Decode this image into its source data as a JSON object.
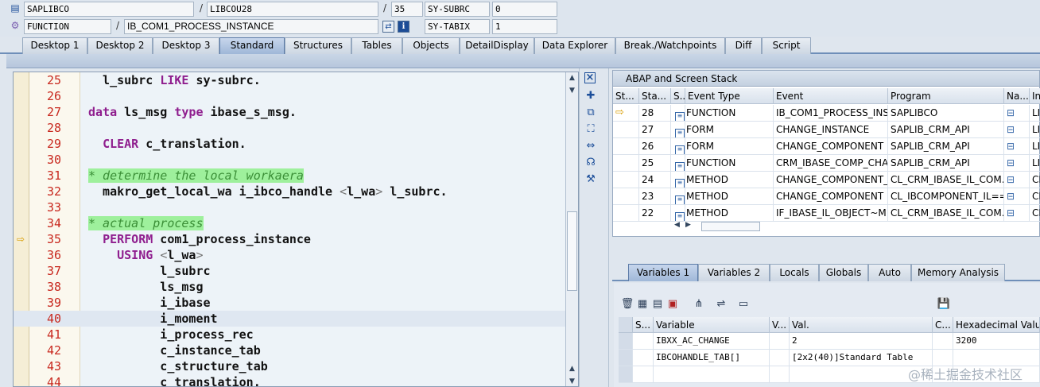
{
  "header": {
    "row1": {
      "program": "SAPLIBCO",
      "include": "LIBCOU28",
      "line": "35",
      "sysfield_label": "SY-SUBRC",
      "sysfield_value": "0"
    },
    "row2": {
      "type": "FUNCTION",
      "name": "IB_COM1_PROCESS_INSTANCE",
      "sysfield_label": "SY-TABIX",
      "sysfield_value": "1"
    },
    "separator": "/",
    "info_label": "i"
  },
  "tabs": [
    "Desktop 1",
    "Desktop 2",
    "Desktop 3",
    "Standard",
    "Structures",
    "Tables",
    "Objects",
    "DetailDisplay",
    "Data Explorer",
    "Break./Watchpoints",
    "Diff",
    "Script"
  ],
  "code": {
    "lines": [
      {
        "n": "25",
        "text": "  l_subrc LIKE sy-subrc."
      },
      {
        "n": "26",
        "text": ""
      },
      {
        "n": "27",
        "text": "data ls_msg type ibase_s_msg."
      },
      {
        "n": "28",
        "text": ""
      },
      {
        "n": "29",
        "text": "  CLEAR c_translation."
      },
      {
        "n": "30",
        "text": ""
      },
      {
        "n": "31",
        "text": "* determine the local workaera"
      },
      {
        "n": "32",
        "text": "  makro_get_local_wa i_ibco_handle <l_wa> l_subrc."
      },
      {
        "n": "33",
        "text": ""
      },
      {
        "n": "34",
        "text": "* actual process"
      },
      {
        "n": "35",
        "text": "  PERFORM com1_process_instance"
      },
      {
        "n": "36",
        "text": "    USING <l_wa>"
      },
      {
        "n": "37",
        "text": "          l_subrc"
      },
      {
        "n": "38",
        "text": "          ls_msg"
      },
      {
        "n": "39",
        "text": "          i_ibase"
      },
      {
        "n": "40",
        "text": "          i_moment"
      },
      {
        "n": "41",
        "text": "          i_process_rec"
      },
      {
        "n": "42",
        "text": "          c_instance_tab"
      },
      {
        "n": "43",
        "text": "          c_structure_tab"
      },
      {
        "n": "44",
        "text": "          c_translation."
      }
    ]
  },
  "stack": {
    "title": "ABAP and Screen Stack",
    "columns": [
      "St...",
      "Sta...",
      "S...",
      "Event Type",
      "Event",
      "Program",
      "Na...",
      "In"
    ],
    "rows": [
      {
        "level": "28",
        "type": "FUNCTION",
        "event": "IB_COM1_PROCESS_INS...",
        "program": "SAPLIBCO",
        "incl": "LI",
        "current": true
      },
      {
        "level": "27",
        "type": "FORM",
        "event": "CHANGE_INSTANCE",
        "program": "SAPLIB_CRM_API",
        "incl": "LI"
      },
      {
        "level": "26",
        "type": "FORM",
        "event": "CHANGE_COMPONENT",
        "program": "SAPLIB_CRM_API",
        "incl": "LI"
      },
      {
        "level": "25",
        "type": "FUNCTION",
        "event": "CRM_IBASE_COMP_CHA...",
        "program": "SAPLIB_CRM_API",
        "incl": "LI"
      },
      {
        "level": "24",
        "type": "METHOD",
        "event": "CHANGE_COMPONENT_...",
        "program": "CL_CRM_IBASE_IL_COM...",
        "incl": "CL"
      },
      {
        "level": "23",
        "type": "METHOD",
        "event": "CHANGE_COMPONENT",
        "program": "CL_IBCOMPONENT_IL==...",
        "incl": "CL"
      },
      {
        "level": "22",
        "type": "METHOD",
        "event": "IF_IBASE_IL_OBJECT~M...",
        "program": "CL_CRM_IBASE_IL_COM...",
        "incl": "CL"
      }
    ]
  },
  "variables": {
    "tabs": [
      "Variables 1",
      "Variables 2",
      "Locals",
      "Globals",
      "Auto",
      "Memory Analysis"
    ],
    "columns": [
      "S...",
      "Variable",
      "V...",
      "Val.",
      "C...",
      "Hexadecimal Value"
    ],
    "rows": [
      {
        "name": "IBXX_AC_CHANGE",
        "value": "2",
        "hex": "3200"
      },
      {
        "name": "IBCOHANDLE_TAB[]",
        "value": "[2x2(40)]Standard Table",
        "hex": ""
      },
      {
        "name": "",
        "value": "",
        "hex": ""
      }
    ]
  },
  "watermark": "@稀土掘金技术社区"
}
